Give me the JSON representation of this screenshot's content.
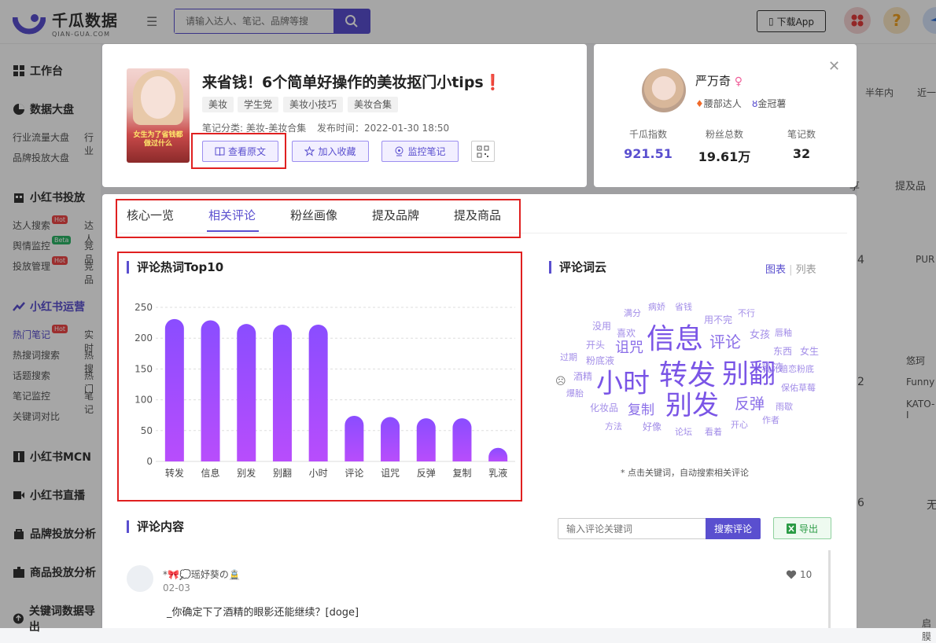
{
  "app": {
    "logo_cn": "千瓜数据",
    "logo_en": "QIAN-GUA.COM",
    "search_placeholder": "请输入达人、笔记、品牌等搜",
    "download_label": "下载App",
    "help_icon": "?"
  },
  "sidebar": {
    "workbench": "工作台",
    "data_board": "数据大盘",
    "data_board_items": [
      "行业流量大盘",
      "行业",
      "品牌投放大盘"
    ],
    "xhs_ads": "小红书投放",
    "xhs_ads_items": [
      "达人搜索",
      "舆情监控",
      "投放管理",
      "达人",
      "竞品",
      "竞品"
    ],
    "xhs_ops": "小红书运营",
    "xhs_ops_items": [
      "热门笔记",
      "热搜词搜索",
      "话题搜索",
      "笔记监控",
      "关键词对比",
      "实时",
      "热搜",
      "热门",
      "笔记"
    ],
    "mcn": "小红书MCN",
    "live": "小红书直播",
    "brand": "品牌投放分析",
    "goods": "商品投放分析",
    "keyword": "关键词数据导出",
    "badges": {
      "hot": "Hot",
      "beta": "Beta"
    }
  },
  "bg_right": {
    "tabs": [
      "半年内",
      "近一"
    ],
    "share": "享",
    "mention": "提及品",
    "values": [
      "4",
      "2",
      "6",
      "无"
    ],
    "brands": [
      "PUR",
      "悠珂",
      "Funny",
      "KATO-I",
      "启膜"
    ]
  },
  "note": {
    "title": "来省钱！6个简单好操作的美妆抠门小tips❗",
    "tags": [
      "美妆",
      "学生党",
      "美妆小技巧",
      "美妆合集"
    ],
    "category": "笔记分类: 美妆-美妆合集",
    "publish_time": "发布时间：2022-01-30 18:50",
    "cover_text": "女生为了省钱都做过什么",
    "actions": {
      "view_original": "查看原文",
      "add_favorite": "加入收藏",
      "monitor_note": "监控笔记"
    }
  },
  "author": {
    "name": "严万奇",
    "gender_symbol": "♀",
    "level_tag": "腰部达人",
    "crown_tag": "金冠薯",
    "stats": [
      {
        "label": "千瓜指数",
        "value": "921.51",
        "color": "#5a4fcf"
      },
      {
        "label": "粉丝总数",
        "value": "19.61万",
        "color": "#222222"
      },
      {
        "label": "笔记数",
        "value": "32",
        "color": "#222222"
      }
    ]
  },
  "tabs": [
    "核心一览",
    "相关评论",
    "粉丝画像",
    "提及品牌",
    "提及商品"
  ],
  "active_tab": "相关评论",
  "sections": {
    "hot_words_title": "评论热词Top10",
    "cloud_title": "评论词云",
    "view_chart": "图表",
    "view_list": "列表",
    "cloud_note": "* 点击关键词，自动搜索相关评论",
    "comments_title": "评论内容"
  },
  "chart_data": {
    "type": "bar",
    "categories": [
      "转发",
      "信息",
      "别发",
      "别翻",
      "小时",
      "评论",
      "诅咒",
      "反弹",
      "复制",
      "乳液"
    ],
    "values": [
      231,
      229,
      223,
      222,
      222,
      74,
      72,
      70,
      70,
      22
    ],
    "ylim": [
      0,
      250
    ],
    "yticks": [
      0,
      50,
      100,
      150,
      200,
      250
    ],
    "grid": true,
    "bar_gradient": [
      "#8a4dff",
      "#b84dfc"
    ]
  },
  "word_cloud": [
    {
      "word": "信息",
      "size": 36
    },
    {
      "word": "转发",
      "size": 36
    },
    {
      "word": "别翻",
      "size": 34
    },
    {
      "word": "小时",
      "size": 34
    },
    {
      "word": "别发",
      "size": 34
    },
    {
      "word": "评论",
      "size": 20
    },
    {
      "word": "诅咒",
      "size": 18
    },
    {
      "word": "反弹",
      "size": 19
    },
    {
      "word": "复制",
      "size": 17
    },
    {
      "word": "乳液",
      "size": 14
    },
    {
      "word": "满分",
      "size": 11
    },
    {
      "word": "病娇",
      "size": 11
    },
    {
      "word": "省钱",
      "size": 11
    },
    {
      "word": "不行",
      "size": 11
    },
    {
      "word": "用不完",
      "size": 12
    },
    {
      "word": "没用",
      "size": 12
    },
    {
      "word": "喜欢",
      "size": 12
    },
    {
      "word": "女孩",
      "size": 13
    },
    {
      "word": "唇釉",
      "size": 11
    },
    {
      "word": "开头",
      "size": 12
    },
    {
      "word": "东西",
      "size": 12
    },
    {
      "word": "女生",
      "size": 12
    },
    {
      "word": "过期",
      "size": 11
    },
    {
      "word": "粉底液",
      "size": 12
    },
    {
      "word": "暗恋粉底",
      "size": 11
    },
    {
      "word": "酒精",
      "size": 12
    },
    {
      "word": "保佑草莓",
      "size": 11
    },
    {
      "word": "爆胎",
      "size": 11
    },
    {
      "word": "化妆品",
      "size": 12
    },
    {
      "word": "雨歇",
      "size": 11
    },
    {
      "word": "作者",
      "size": 11
    },
    {
      "word": "方法",
      "size": 11
    },
    {
      "word": "好像",
      "size": 12
    },
    {
      "word": "论坛",
      "size": 11
    },
    {
      "word": "看着",
      "size": 11
    },
    {
      "word": "开心",
      "size": 11
    }
  ],
  "comments": {
    "search_placeholder": "输入评论关键词",
    "search_button": "搜索评论",
    "export_button": "导出",
    "items": [
      {
        "name": "*🎀💭瑶妤葵の🚊",
        "date": "02-03",
        "text": "_你确定下了酒精的眼影还能继续？[doge]",
        "likes": "10"
      }
    ]
  }
}
